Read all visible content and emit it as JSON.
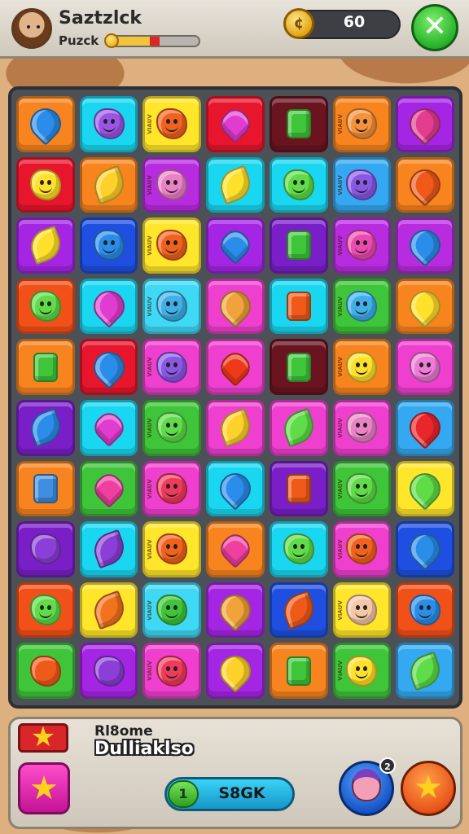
{
  "header": {
    "player_name": "Saztzlck",
    "player_subtitle": "Puzck",
    "xp_progress": 0.45,
    "coin_symbol": "¢",
    "coin_value": "60",
    "close_symbol": "✕"
  },
  "tile_side_label": "VIAUV",
  "board": {
    "rows": [
      [
        {
          "bg": "#f7841f",
          "shape": "drop",
          "color": "#2b8dea",
          "face": false,
          "label": false
        },
        {
          "bg": "#19d7f0",
          "shape": "blob",
          "color": "#9b55e6",
          "face": true,
          "label": false
        },
        {
          "bg": "#ffe62a",
          "shape": "blob",
          "color": "#f2621e",
          "face": true,
          "label": true
        },
        {
          "bg": "#e8162c",
          "shape": "heart",
          "color": "#e03ccf",
          "face": false,
          "label": false
        },
        {
          "bg": "#6a1420",
          "shape": "box",
          "color": "#3fc53a",
          "face": false,
          "label": false
        },
        {
          "bg": "#f7841f",
          "shape": "blob",
          "color": "#f6923a",
          "face": true,
          "label": true
        },
        {
          "bg": "#a425e3",
          "shape": "drop",
          "color": "#e23d8f",
          "face": false,
          "label": false
        }
      ],
      [
        {
          "bg": "#e8162c",
          "shape": "blob",
          "color": "#ffe02a",
          "face": true,
          "label": false
        },
        {
          "bg": "#f7841f",
          "shape": "leaf",
          "color": "#ffd22b",
          "face": false,
          "label": false
        },
        {
          "bg": "#b82ce0",
          "shape": "blob",
          "color": "#ec82c6",
          "face": true,
          "label": true
        },
        {
          "bg": "#19d7f0",
          "shape": "leaf",
          "color": "#ffe02a",
          "face": false,
          "label": false
        },
        {
          "bg": "#19d7f0",
          "shape": "blob",
          "color": "#5fdc47",
          "face": true,
          "label": false
        },
        {
          "bg": "#34a8f0",
          "shape": "blob",
          "color": "#8a58e6",
          "face": true,
          "label": true
        },
        {
          "bg": "#f7841f",
          "shape": "drop",
          "color": "#ef5a1a",
          "face": false,
          "label": false
        }
      ],
      [
        {
          "bg": "#a425e3",
          "shape": "leaf",
          "color": "#ffe02a",
          "face": false,
          "label": false
        },
        {
          "bg": "#1f4fe0",
          "shape": "blob",
          "color": "#2b8dea",
          "face": true,
          "label": false
        },
        {
          "bg": "#ffe62a",
          "shape": "blob",
          "color": "#f2621e",
          "face": true,
          "label": true
        },
        {
          "bg": "#a425e3",
          "shape": "heart",
          "color": "#2b8dea",
          "face": false,
          "label": false
        },
        {
          "bg": "#7a1fc7",
          "shape": "box",
          "color": "#3fc53a",
          "face": false,
          "label": false
        },
        {
          "bg": "#b82ce0",
          "shape": "blob",
          "color": "#ec4ab0",
          "face": true,
          "label": true
        },
        {
          "bg": "#b82ce0",
          "shape": "drop",
          "color": "#2b8dea",
          "face": false,
          "label": false
        }
      ],
      [
        {
          "bg": "#f25019",
          "shape": "blob",
          "color": "#5fdc47",
          "face": true,
          "label": false
        },
        {
          "bg": "#19d7f0",
          "shape": "drop",
          "color": "#e03ccf",
          "face": false,
          "label": false
        },
        {
          "bg": "#3fd9f5",
          "shape": "blob",
          "color": "#3fb0e8",
          "face": true,
          "label": true
        },
        {
          "bg": "#ef3fcf",
          "shape": "drop",
          "color": "#f0a33a",
          "face": false,
          "label": false
        },
        {
          "bg": "#19d7f0",
          "shape": "box",
          "color": "#ef5a1a",
          "face": false,
          "label": false
        },
        {
          "bg": "#3fc53a",
          "shape": "blob",
          "color": "#3fb0e8",
          "face": true,
          "label": true
        },
        {
          "bg": "#f7841f",
          "shape": "drop",
          "color": "#ffe02a",
          "face": false,
          "label": false
        }
      ],
      [
        {
          "bg": "#f7841f",
          "shape": "box",
          "color": "#3fc53a",
          "face": false,
          "label": false
        },
        {
          "bg": "#e8162c",
          "shape": "drop",
          "color": "#2b8dea",
          "face": false,
          "label": false
        },
        {
          "bg": "#ef3fcf",
          "shape": "blob",
          "color": "#8a58e6",
          "face": true,
          "label": true
        },
        {
          "bg": "#ef3fcf",
          "shape": "heart",
          "color": "#ef3a1a",
          "face": false,
          "label": false
        },
        {
          "bg": "#6a1420",
          "shape": "box",
          "color": "#3fc53a",
          "face": false,
          "label": false
        },
        {
          "bg": "#f7841f",
          "shape": "blob",
          "color": "#ffe02a",
          "face": true,
          "label": true
        },
        {
          "bg": "#ef3fcf",
          "shape": "blob",
          "color": "#ef7ad8",
          "face": true,
          "label": false
        }
      ],
      [
        {
          "bg": "#7a1fc7",
          "shape": "leaf",
          "color": "#2b8dea",
          "face": false,
          "label": false
        },
        {
          "bg": "#19d7f0",
          "shape": "heart",
          "color": "#e03ccf",
          "face": false,
          "label": false
        },
        {
          "bg": "#3fc53a",
          "shape": "blob",
          "color": "#5fdc47",
          "face": true,
          "label": true
        },
        {
          "bg": "#ef3fcf",
          "shape": "leaf",
          "color": "#ffd22b",
          "face": false,
          "label": false
        },
        {
          "bg": "#ef3fcf",
          "shape": "leaf",
          "color": "#5fdc47",
          "face": false,
          "label": false
        },
        {
          "bg": "#ef3fcf",
          "shape": "blob",
          "color": "#ec82c6",
          "face": true,
          "label": true
        },
        {
          "bg": "#34a8f0",
          "shape": "drop",
          "color": "#e8262c",
          "face": false,
          "label": false
        }
      ],
      [
        {
          "bg": "#f7841f",
          "shape": "box",
          "color": "#3f8ee0",
          "face": false,
          "label": false
        },
        {
          "bg": "#3fc53a",
          "shape": "heart",
          "color": "#ef3fa0",
          "face": false,
          "label": false
        },
        {
          "bg": "#ef3fcf",
          "shape": "blob",
          "color": "#ef3a5a",
          "face": true,
          "label": true
        },
        {
          "bg": "#19d7f0",
          "shape": "drop",
          "color": "#2b8dea",
          "face": false,
          "label": false
        },
        {
          "bg": "#7a1fc7",
          "shape": "box",
          "color": "#ef5a1a",
          "face": false,
          "label": false
        },
        {
          "bg": "#3fc53a",
          "shape": "blob",
          "color": "#5fdc47",
          "face": true,
          "label": true
        },
        {
          "bg": "#ffe62a",
          "shape": "drop",
          "color": "#5fdc47",
          "face": false,
          "label": false
        }
      ],
      [
        {
          "bg": "#7a1fc7",
          "shape": "blob",
          "color": "#8a3fd6",
          "face": false,
          "label": false
        },
        {
          "bg": "#19d7f0",
          "shape": "leaf",
          "color": "#8a3fd6",
          "face": false,
          "label": false
        },
        {
          "bg": "#ffe62a",
          "shape": "blob",
          "color": "#f2621e",
          "face": true,
          "label": true
        },
        {
          "bg": "#f7841f",
          "shape": "heart",
          "color": "#ef3fa0",
          "face": false,
          "label": false
        },
        {
          "bg": "#19d7f0",
          "shape": "blob",
          "color": "#5fdc47",
          "face": true,
          "label": false
        },
        {
          "bg": "#ef3fcf",
          "shape": "blob",
          "color": "#f2621e",
          "face": true,
          "label": true
        },
        {
          "bg": "#1f4fe0",
          "shape": "drop",
          "color": "#2b8dea",
          "face": false,
          "label": false
        }
      ],
      [
        {
          "bg": "#f25019",
          "shape": "blob",
          "color": "#5fdc47",
          "face": true,
          "label": false
        },
        {
          "bg": "#ffe62a",
          "shape": "leaf",
          "color": "#f2721e",
          "face": false,
          "label": false
        },
        {
          "bg": "#3fd9f5",
          "shape": "blob",
          "color": "#3fc53a",
          "face": true,
          "label": true
        },
        {
          "bg": "#a425e3",
          "shape": "drop",
          "color": "#f0a33a",
          "face": false,
          "label": false
        },
        {
          "bg": "#1f4fe0",
          "shape": "leaf",
          "color": "#ef5a1a",
          "face": false,
          "label": false
        },
        {
          "bg": "#ffe62a",
          "shape": "blob",
          "color": "#f5c7a6",
          "face": true,
          "label": true
        },
        {
          "bg": "#f25019",
          "shape": "blob",
          "color": "#2b8dea",
          "face": true,
          "label": false
        }
      ],
      [
        {
          "bg": "#3fc53a",
          "shape": "blob",
          "color": "#ef5a1a",
          "face": false,
          "label": false
        },
        {
          "bg": "#a425e3",
          "shape": "blob",
          "color": "#8a3fd6",
          "face": false,
          "label": false
        },
        {
          "bg": "#ef3fcf",
          "shape": "blob",
          "color": "#ef3a5a",
          "face": true,
          "label": true
        },
        {
          "bg": "#a425e3",
          "shape": "drop",
          "color": "#ffd22b",
          "face": false,
          "label": false
        },
        {
          "bg": "#f7841f",
          "shape": "box",
          "color": "#3fc53a",
          "face": false,
          "label": false
        },
        {
          "bg": "#3fc53a",
          "shape": "blob",
          "color": "#ffe02a",
          "face": true,
          "label": true
        },
        {
          "bg": "#34a8f0",
          "shape": "leaf",
          "color": "#5fdc47",
          "face": false,
          "label": false
        }
      ]
    ]
  },
  "footer": {
    "star_symbol": "★",
    "panel_title": "Rl8ome",
    "panel_subtitle": "Dulliaklso",
    "booster_symbol": "★",
    "action_icon": "1",
    "action_label": "S8GK",
    "friend_badge": "2",
    "favorite_symbol": "★"
  }
}
